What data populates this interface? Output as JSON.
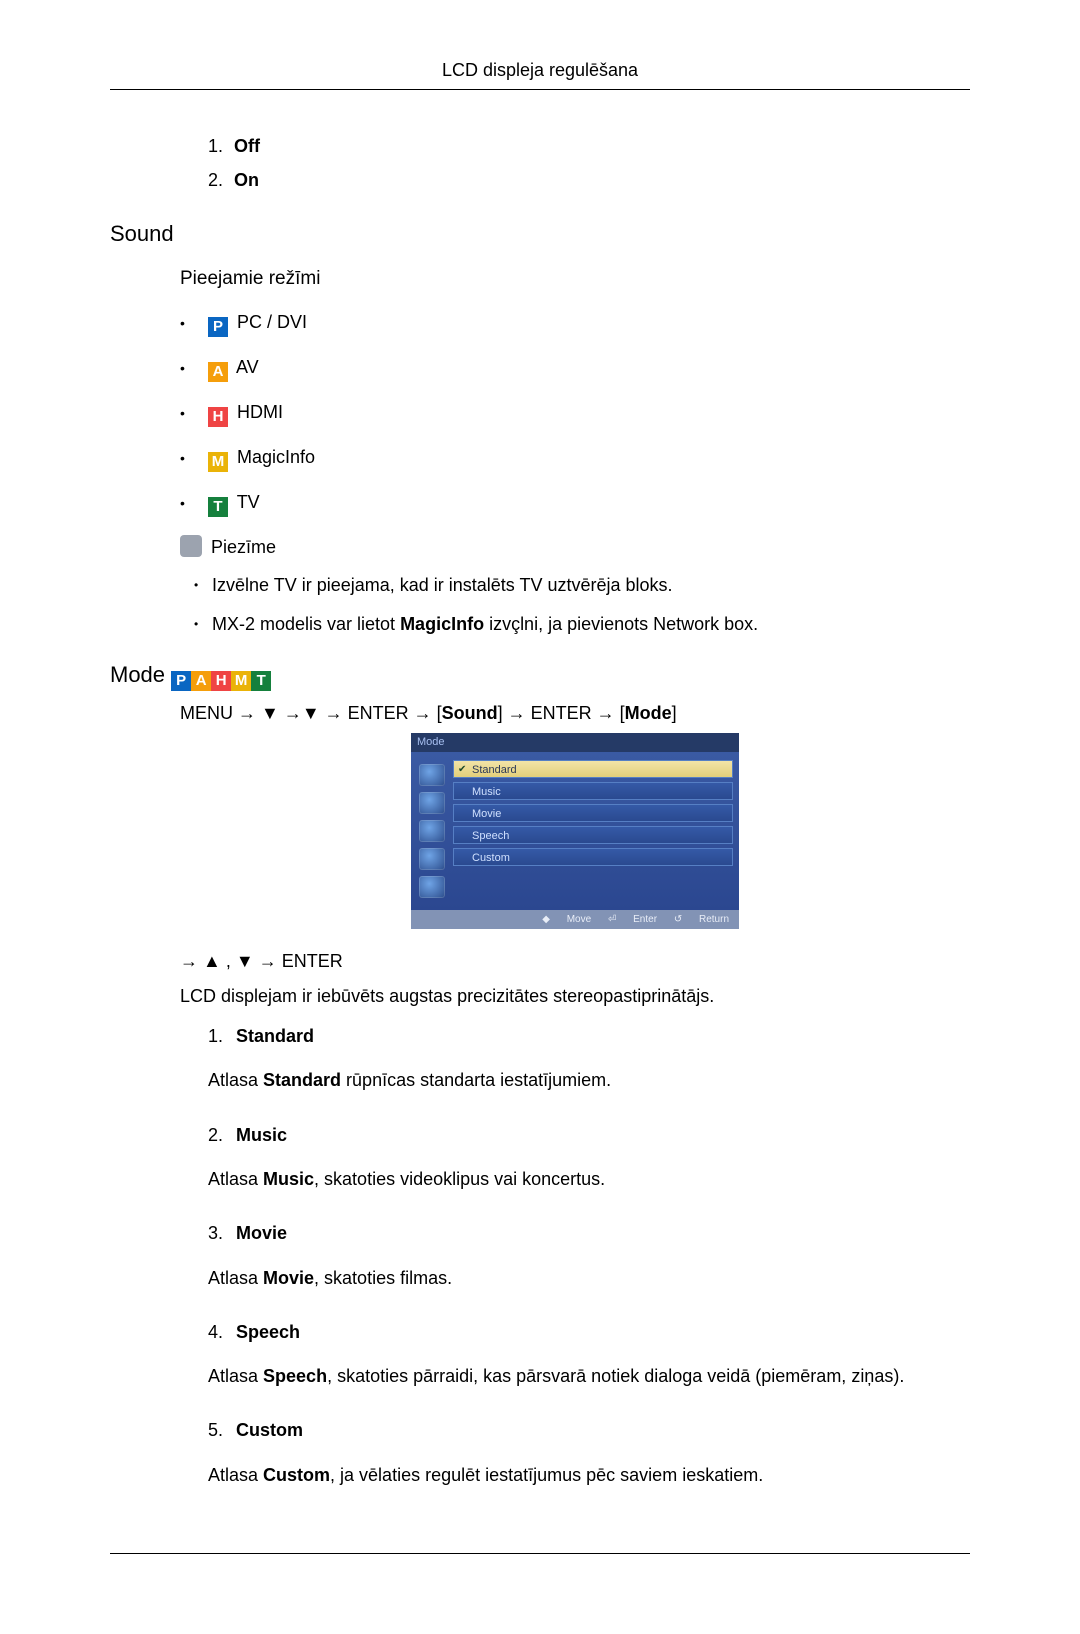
{
  "header": "LCD displeja regulēšana",
  "offOn": [
    {
      "n": "1.",
      "label": "Off"
    },
    {
      "n": "2.",
      "label": "On"
    }
  ],
  "sound": {
    "title": "Sound",
    "availableModes": "Pieejamie režīmi",
    "modes": [
      {
        "badge": "P",
        "label": "PC / DVI"
      },
      {
        "badge": "A",
        "label": "AV"
      },
      {
        "badge": "H",
        "label": "HDMI"
      },
      {
        "badge": "M",
        "label": "MagicInfo"
      },
      {
        "badge": "T",
        "label": "TV"
      }
    ],
    "noteLabel": "Piezīme",
    "notes": [
      "Izvēlne TV ir pieejama, kad ir instalēts TV uztvērēja bloks.",
      "MX-2 modelis var lietot MagicInfo izvçlni, ja pievienots Network box."
    ]
  },
  "mode": {
    "title": "Mode",
    "path1": "MENU → ",
    "path2": " → ENTER → [",
    "pathSound": "Sound",
    "path3": "] → ENTER → [",
    "pathMode": "Mode",
    "path4": "]",
    "osdTitle": "Mode",
    "osdItems": [
      "Standard",
      "Music",
      "Movie",
      "Speech",
      "Custom"
    ],
    "osdFooter": {
      "move": "Move",
      "enter": "Enter",
      "return": "Return"
    },
    "navEnter": " → ENTER",
    "body": "LCD displejam ir iebūvēts augstas precizitātes stereopastiprinātājs.",
    "items": [
      {
        "n": "1.",
        "label": "Standard",
        "desc_pre": "Atlasa ",
        "desc_bold": "Standard",
        "desc_post": " rūpnīcas standarta iestatījumiem."
      },
      {
        "n": "2.",
        "label": "Music",
        "desc_pre": "Atlasa ",
        "desc_bold": "Music",
        "desc_post": ", skatoties videoklipus vai koncertus."
      },
      {
        "n": "3.",
        "label": "Movie",
        "desc_pre": "Atlasa ",
        "desc_bold": "Movie",
        "desc_post": ", skatoties filmas."
      },
      {
        "n": "4.",
        "label": "Speech",
        "desc_pre": "Atlasa ",
        "desc_bold": "Speech",
        "desc_post": ", skatoties pārraidi, kas pārsvarā notiek dialoga veidā (piemēram, ziņas)."
      },
      {
        "n": "5.",
        "label": "Custom",
        "desc_pre": "Atlasa ",
        "desc_bold": "Custom",
        "desc_post": ", ja vēlaties regulēt iestatījumus pēc saviem ieskatiem."
      }
    ]
  }
}
